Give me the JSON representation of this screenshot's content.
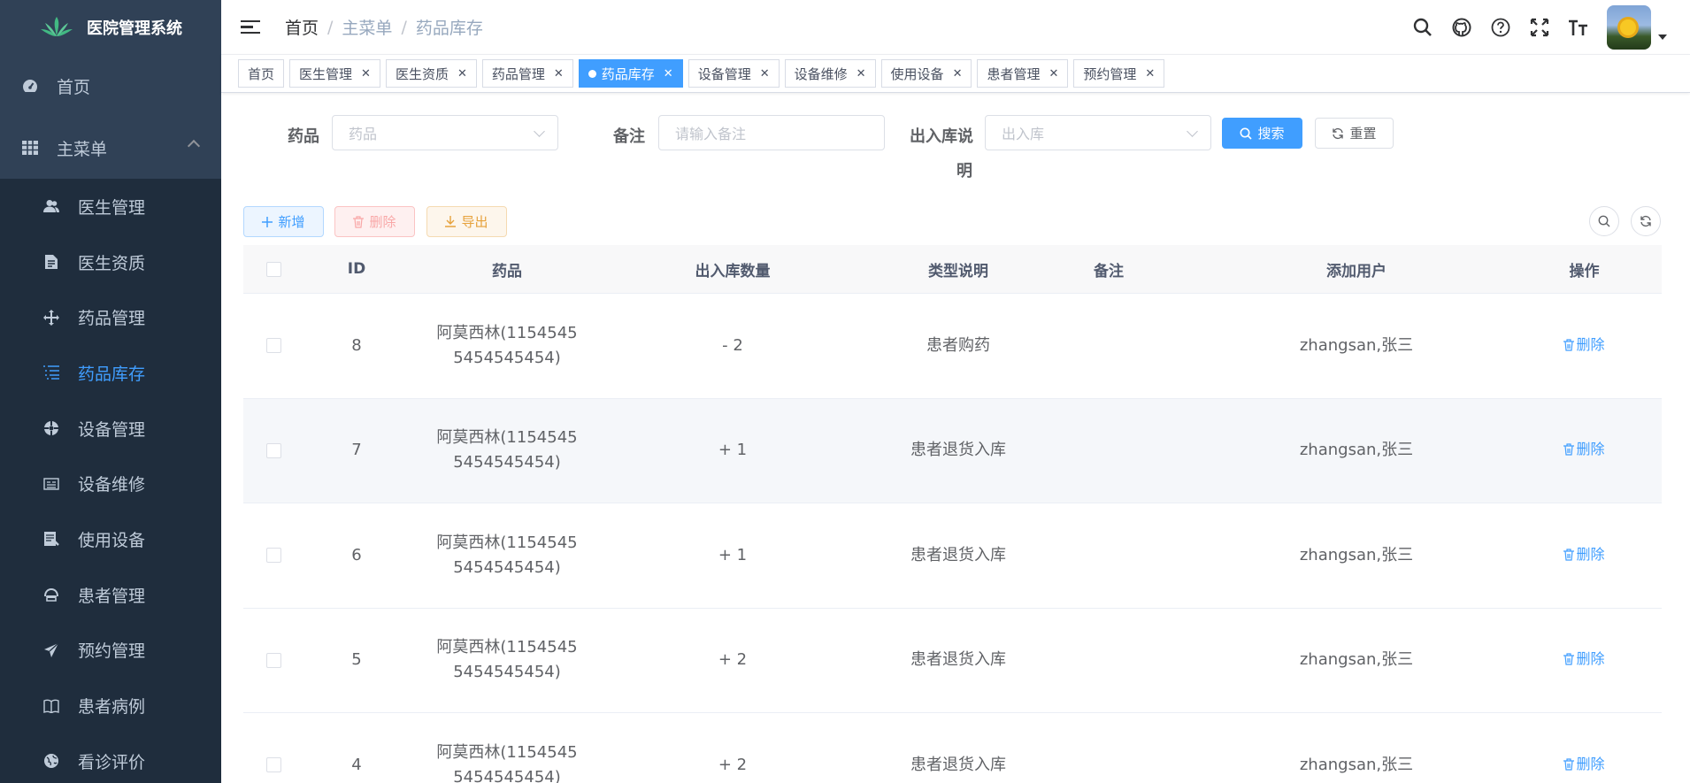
{
  "app": {
    "title": "医院管理系统"
  },
  "sidebar": {
    "home": "首页",
    "main_menu": "主菜单",
    "items": [
      {
        "label": "医生管理",
        "icon": "peoples-icon"
      },
      {
        "label": "医生资质",
        "icon": "document-icon"
      },
      {
        "label": "药品管理",
        "icon": "drag-icon"
      },
      {
        "label": "药品库存",
        "icon": "tree-table-icon"
      },
      {
        "label": "设备管理",
        "icon": "component-icon"
      },
      {
        "label": "设备维修",
        "icon": "log-icon"
      },
      {
        "label": "使用设备",
        "icon": "form-icon"
      },
      {
        "label": "患者管理",
        "icon": "people-icon"
      },
      {
        "label": "预约管理",
        "icon": "send-icon"
      },
      {
        "label": "患者病例",
        "icon": "book-icon"
      },
      {
        "label": "看诊评价",
        "icon": "globe-icon"
      }
    ]
  },
  "breadcrumb": [
    "首页",
    "主菜单",
    "药品库存"
  ],
  "tags": [
    "首页",
    "医生管理",
    "医生资质",
    "药品管理",
    "药品库存",
    "设备管理",
    "设备维修",
    "使用设备",
    "患者管理",
    "预约管理"
  ],
  "form": {
    "drug_label": "药品",
    "drug_placeholder": "药品",
    "remark_label": "备注",
    "remark_placeholder": "请输入备注",
    "inout_label_1": "出入库说",
    "inout_label_2": "明",
    "inout_placeholder": "出入库",
    "search": "搜索",
    "reset": "重置"
  },
  "toolbar": {
    "add": "新增",
    "delete": "删除",
    "export": "导出"
  },
  "table": {
    "columns": [
      "ID",
      "药品",
      "出入库数量",
      "类型说明",
      "备注",
      "添加用户",
      "操作"
    ],
    "delete_label": "删除",
    "rows": [
      {
        "id": "8",
        "drug_1": "阿莫西林(1154545",
        "drug_2": "5454545454)",
        "qty": "- 2",
        "type": "患者购药",
        "remark": "",
        "user": "zhangsan,张三"
      },
      {
        "id": "7",
        "drug_1": "阿莫西林(1154545",
        "drug_2": "5454545454)",
        "qty": "+ 1",
        "type": "患者退货入库",
        "remark": "",
        "user": "zhangsan,张三"
      },
      {
        "id": "6",
        "drug_1": "阿莫西林(1154545",
        "drug_2": "5454545454)",
        "qty": "+ 1",
        "type": "患者退货入库",
        "remark": "",
        "user": "zhangsan,张三"
      },
      {
        "id": "5",
        "drug_1": "阿莫西林(1154545",
        "drug_2": "5454545454)",
        "qty": "+ 2",
        "type": "患者退货入库",
        "remark": "",
        "user": "zhangsan,张三"
      },
      {
        "id": "4",
        "drug_1": "阿莫西林(1154545",
        "drug_2": "5454545454)",
        "qty": "+ 2",
        "type": "患者退货入库",
        "remark": "",
        "user": "zhangsan,张三"
      }
    ]
  },
  "colors": {
    "primary": "#409eff",
    "sidebar_bg": "#304156",
    "submenu_bg": "#1f2d3d"
  }
}
